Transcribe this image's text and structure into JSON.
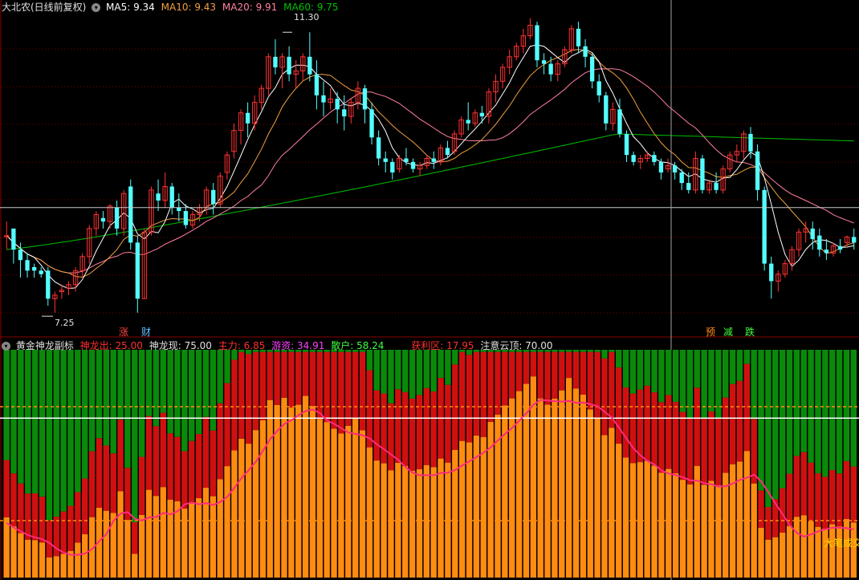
{
  "colors": {
    "bg": "#000000",
    "up": "#ff3232",
    "down": "#54ffff",
    "ma5": "#ffffff",
    "ma10": "#f0a040",
    "ma20": "#ff80a0",
    "ma60": "#00c000",
    "grid": "#7a0000",
    "green_bar": "#0a8a0a",
    "red_bar": "#d01010",
    "orange_bar": "#ff8c10",
    "pink_line": "#ff2a80"
  },
  "top": {
    "title": "大北农(日线前复权)",
    "ma5": "MA5: 9.34",
    "ma10": "MA10: 9.43",
    "ma20": "MA20: 9.91",
    "ma60": "MA60: 9.75",
    "high_label": "11.30",
    "low_label": "7.25",
    "arrow_icon": "chevron-down-icon"
  },
  "signals": [
    "涨",
    "财",
    "预",
    "减",
    "跌"
  ],
  "bottom": {
    "title": "黄金神龙副标",
    "items": [
      {
        "label": "神龙出: 25.00",
        "color": "#ff3030"
      },
      {
        "label": "神龙现: 75.00",
        "color": "#e0e0e0"
      },
      {
        "label": "主力: 6.85",
        "color": "#ff3030"
      },
      {
        "label": "游资: 34.91",
        "color": "#ff40ff"
      },
      {
        "label": "散户: 58.24",
        "color": "#40ff40"
      },
      {
        "label": "获利区: 17.95",
        "color": "#ff3030"
      },
      {
        "label": "注意云顶: 70.00",
        "color": "#e0e0e0"
      }
    ],
    "corner_label": "大笔成交"
  },
  "chart_data": [
    {
      "type": "candlestick",
      "title": "大北农(日线前复权)",
      "series_legend": [
        "MA5",
        "MA10",
        "MA20",
        "MA60"
      ],
      "ylim": [
        7.0,
        11.6
      ],
      "annotated_high": 11.3,
      "annotated_low": 7.25,
      "crosshair_price": 8.8,
      "ma60_start": 8.2,
      "ma60_peak": 9.85,
      "ma60_end": 9.75,
      "ohlc": [
        [
          8.38,
          8.6,
          8.4,
          8.2
        ],
        [
          8.5,
          8.5,
          8.2,
          8.0
        ],
        [
          8.2,
          8.3,
          8.05,
          7.8
        ],
        [
          8.05,
          8.15,
          7.9,
          7.8
        ],
        [
          7.95,
          8.0,
          7.9,
          7.8
        ],
        [
          7.9,
          7.95,
          7.85,
          7.8
        ],
        [
          7.9,
          7.95,
          7.5,
          7.4
        ],
        [
          7.5,
          7.6,
          7.55,
          7.3
        ],
        [
          7.6,
          7.7,
          7.62,
          7.5
        ],
        [
          7.65,
          7.75,
          7.7,
          7.55
        ],
        [
          7.7,
          7.95,
          7.9,
          7.6
        ],
        [
          7.9,
          8.15,
          8.1,
          7.8
        ],
        [
          8.1,
          8.55,
          8.5,
          8.0
        ],
        [
          8.5,
          8.75,
          8.7,
          8.4
        ],
        [
          8.65,
          8.75,
          8.6,
          8.5
        ],
        [
          8.6,
          8.85,
          8.82,
          8.5
        ],
        [
          8.8,
          8.9,
          8.5,
          8.4
        ],
        [
          8.5,
          9.05,
          9.0,
          8.4
        ],
        [
          9.1,
          9.2,
          8.3,
          8.2
        ],
        [
          8.3,
          8.4,
          7.5,
          7.3
        ],
        [
          7.5,
          8.5,
          8.45,
          7.5
        ],
        [
          8.45,
          9.1,
          9.05,
          8.4
        ],
        [
          9.0,
          9.2,
          8.9,
          8.75
        ],
        [
          8.9,
          9.3,
          9.1,
          8.8
        ],
        [
          9.1,
          9.15,
          8.8,
          8.7
        ],
        [
          8.8,
          9.0,
          8.75,
          8.6
        ],
        [
          8.75,
          8.85,
          8.55,
          8.5
        ],
        [
          8.55,
          8.75,
          8.7,
          8.5
        ],
        [
          8.7,
          8.85,
          8.8,
          8.6
        ],
        [
          8.8,
          9.1,
          9.05,
          8.7
        ],
        [
          9.05,
          9.15,
          8.85,
          8.7
        ],
        [
          8.85,
          9.3,
          9.25,
          8.8
        ],
        [
          9.3,
          9.6,
          9.55,
          9.2
        ],
        [
          9.6,
          10.0,
          9.9,
          9.5
        ],
        [
          9.9,
          10.2,
          10.15,
          9.7
        ],
        [
          10.15,
          10.3,
          10.0,
          9.8
        ],
        [
          10.0,
          10.4,
          10.3,
          9.9
        ],
        [
          10.3,
          10.55,
          10.5,
          10.2
        ],
        [
          10.5,
          11.0,
          10.95,
          10.4
        ],
        [
          10.95,
          11.2,
          10.8,
          10.7
        ],
        [
          10.8,
          11.0,
          10.95,
          10.5
        ],
        [
          10.95,
          11.1,
          10.7,
          10.6
        ],
        [
          10.7,
          10.9,
          10.75,
          10.5
        ],
        [
          10.75,
          11.0,
          10.95,
          10.6
        ],
        [
          10.95,
          11.3,
          10.7,
          10.6
        ],
        [
          10.7,
          10.9,
          10.4,
          10.2
        ],
        [
          10.4,
          10.6,
          10.3,
          10.1
        ],
        [
          10.3,
          10.5,
          10.35,
          10.2
        ],
        [
          10.35,
          10.45,
          10.2,
          10.0
        ],
        [
          10.2,
          10.4,
          10.1,
          9.9
        ],
        [
          10.1,
          10.35,
          10.3,
          10.0
        ],
        [
          10.3,
          10.6,
          10.5,
          10.2
        ],
        [
          10.5,
          10.55,
          10.2,
          10.0
        ],
        [
          10.2,
          10.3,
          9.8,
          9.7
        ],
        [
          9.8,
          9.9,
          9.5,
          9.4
        ],
        [
          9.5,
          9.6,
          9.45,
          9.3
        ],
        [
          9.45,
          9.5,
          9.3,
          9.2
        ],
        [
          9.35,
          9.55,
          9.5,
          9.3
        ],
        [
          9.5,
          9.65,
          9.45,
          9.4
        ],
        [
          9.45,
          9.5,
          9.35,
          9.3
        ],
        [
          9.35,
          9.45,
          9.4,
          9.25
        ],
        [
          9.4,
          9.55,
          9.5,
          9.35
        ],
        [
          9.5,
          9.6,
          9.45,
          9.35
        ],
        [
          9.45,
          9.7,
          9.65,
          9.4
        ],
        [
          9.65,
          9.75,
          9.55,
          9.5
        ],
        [
          9.6,
          9.9,
          9.85,
          9.55
        ],
        [
          9.85,
          10.1,
          10.05,
          9.8
        ],
        [
          10.05,
          10.3,
          10.0,
          9.9
        ],
        [
          10.0,
          10.2,
          10.15,
          9.95
        ],
        [
          10.15,
          10.25,
          10.1,
          10.0
        ],
        [
          10.1,
          10.5,
          10.45,
          10.0
        ],
        [
          10.45,
          10.7,
          10.6,
          10.3
        ],
        [
          10.6,
          10.85,
          10.8,
          10.5
        ],
        [
          10.8,
          11.05,
          10.95,
          10.7
        ],
        [
          10.95,
          11.15,
          11.1,
          10.9
        ],
        [
          11.1,
          11.35,
          11.25,
          11.0
        ],
        [
          11.25,
          11.5,
          11.4,
          11.2
        ],
        [
          11.4,
          11.45,
          10.9,
          10.8
        ],
        [
          10.9,
          11.0,
          10.85,
          10.7
        ],
        [
          10.85,
          10.95,
          10.7,
          10.6
        ],
        [
          10.7,
          10.9,
          10.85,
          10.6
        ],
        [
          10.85,
          11.1,
          11.05,
          10.8
        ],
        [
          11.05,
          11.4,
          11.35,
          11.0
        ],
        [
          11.35,
          11.45,
          11.1,
          11.0
        ],
        [
          11.1,
          11.2,
          10.95,
          10.8
        ],
        [
          10.95,
          11.0,
          10.6,
          10.5
        ],
        [
          10.6,
          10.7,
          10.4,
          10.3
        ],
        [
          10.4,
          10.45,
          10.0,
          9.9
        ],
        [
          10.0,
          10.3,
          10.2,
          9.9
        ],
        [
          10.2,
          10.35,
          9.85,
          9.8
        ],
        [
          9.85,
          9.9,
          9.55,
          9.45
        ],
        [
          9.55,
          9.6,
          9.45,
          9.4
        ],
        [
          9.45,
          9.55,
          9.5,
          9.35
        ],
        [
          9.5,
          9.6,
          9.55,
          9.45
        ],
        [
          9.55,
          9.6,
          9.45,
          9.4
        ],
        [
          9.45,
          9.5,
          9.3,
          9.2
        ],
        [
          9.35,
          9.5,
          9.4,
          9.3
        ],
        [
          9.4,
          9.45,
          9.3,
          9.2
        ],
        [
          9.3,
          9.35,
          9.15,
          9.05
        ],
        [
          9.15,
          9.3,
          9.05,
          9.0
        ],
        [
          9.05,
          9.6,
          9.5,
          9.0
        ],
        [
          9.5,
          9.55,
          9.05,
          9.0
        ],
        [
          9.05,
          9.2,
          9.15,
          9.0
        ],
        [
          9.15,
          9.3,
          9.05,
          9.0
        ],
        [
          9.05,
          9.4,
          9.35,
          9.0
        ],
        [
          9.35,
          9.6,
          9.55,
          9.3
        ],
        [
          9.55,
          9.7,
          9.6,
          9.45
        ],
        [
          9.6,
          9.9,
          9.85,
          9.5
        ],
        [
          9.85,
          9.95,
          9.6,
          9.5
        ],
        [
          9.6,
          9.7,
          9.05,
          8.9
        ],
        [
          9.05,
          9.1,
          8.0,
          7.9
        ],
        [
          8.0,
          8.1,
          7.75,
          7.5
        ],
        [
          7.75,
          7.9,
          7.85,
          7.6
        ],
        [
          7.85,
          8.05,
          8.0,
          7.8
        ],
        [
          8.0,
          8.25,
          8.2,
          7.9
        ],
        [
          8.2,
          8.5,
          8.45,
          8.1
        ],
        [
          8.45,
          8.6,
          8.5,
          8.3
        ],
        [
          8.5,
          8.6,
          8.35,
          8.2
        ],
        [
          8.4,
          8.5,
          8.2,
          8.1
        ],
        [
          8.2,
          8.35,
          8.15,
          8.05
        ],
        [
          8.15,
          8.3,
          8.25,
          8.1
        ],
        [
          8.25,
          8.35,
          8.2,
          8.15
        ],
        [
          8.3,
          8.4,
          8.38,
          8.25
        ],
        [
          8.38,
          8.5,
          8.3,
          8.2
        ]
      ]
    },
    {
      "type": "bar",
      "title": "黄金神龙副标",
      "stacked": true,
      "ylim": [
        0,
        100
      ],
      "levels": {
        "神龙出": 25.0,
        "神龙现": 75.0,
        "注意云顶": 70.0,
        "获利区": 17.95
      },
      "series": [
        {
          "name": "散户",
          "color": "#0a8a0a"
        },
        {
          "name": "游资",
          "color": "#ff2a80"
        },
        {
          "name": "主力",
          "color": "#ff8c10"
        }
      ]
    }
  ]
}
